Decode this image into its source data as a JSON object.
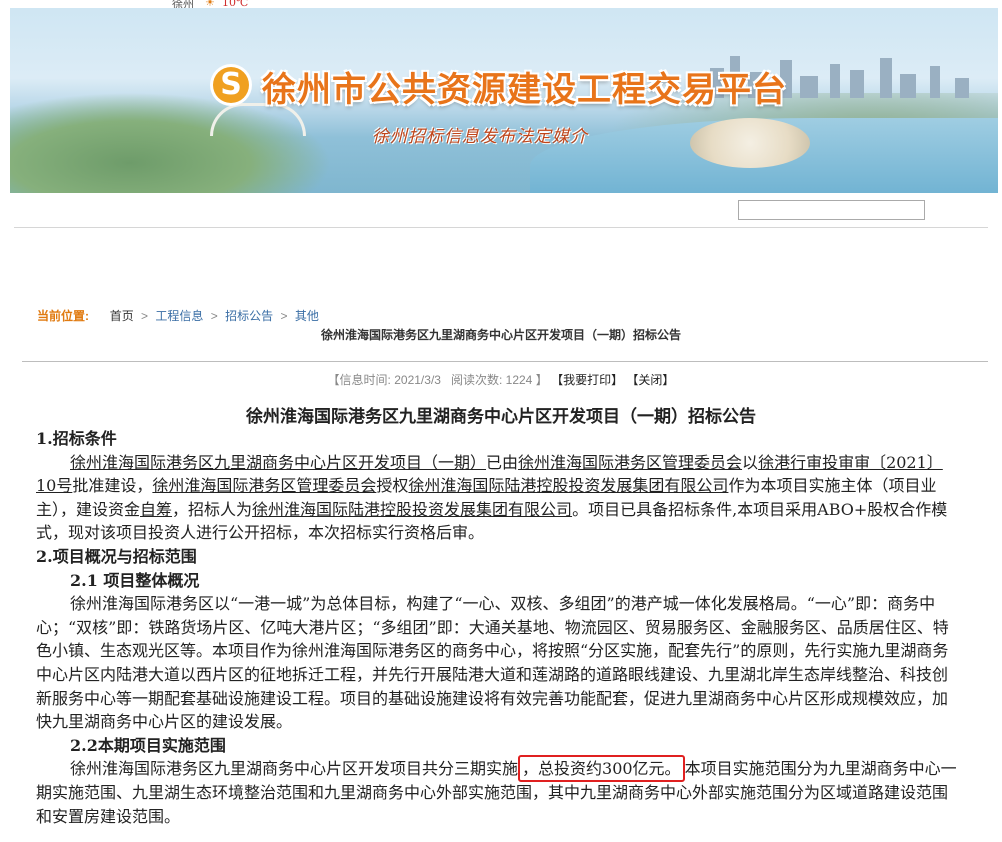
{
  "topstrip": {
    "city": "徐州",
    "weather_text": "10℃"
  },
  "banner": {
    "logo_char": "S",
    "title": "徐州市公共资源建设工程交易平台",
    "subtitle": "徐州招标信息发布法定媒介"
  },
  "breadcrumb": {
    "label": "当前位置:",
    "items": [
      "首页",
      "工程信息",
      "招标公告",
      "其他"
    ],
    "separator": ">"
  },
  "page_heading": "徐州淮海国际港务区九里湖商务中心片区开发项目（一期）招标公告",
  "meta": {
    "info_time_label": "【信息时间:",
    "info_time": "2021/3/3",
    "read_label": "阅读次数:",
    "read_count": "1224",
    "print_label": "【我要打印】",
    "close_label": "【关闭】"
  },
  "document": {
    "title": "徐州淮海国际港务区九里湖商务中心片区开发项目（一期）招标公告",
    "s1_heading": "1.招标条件",
    "s1_p1_a": "徐州淮海国际港务区九里湖商务中心片区开发项目（一期）",
    "s1_p1_b": "已由",
    "s1_p1_c": "徐州淮海国际港务区管理委员会",
    "s1_p1_d": "以",
    "s1_p1_e": "徐港行审投审审〔2021〕10号",
    "s1_p1_f": "批准建设，",
    "s1_p1_g": "徐州淮海国际港务区管理委员会",
    "s1_p1_h": "授权",
    "s1_p1_i": "徐州淮海国际陆港控股投资发展集团有限公司",
    "s1_p1_j": "作为本项目实施主体（项目业主），建设资金",
    "s1_p1_k": "自筹",
    "s1_p1_l": "，招标人为",
    "s1_p1_m": "徐州淮海国际陆港控股投资发展集团有限公司",
    "s1_p1_n": "。项目已具备招标条件,本项目采用ABO+股权合作模式，现对该项目投资人进行公开招标，本次招标实行资格后审。",
    "s2_heading": "2.项目概况与招标范围",
    "s21_heading": "2.1 项目整体概况",
    "s21_body": "徐州淮海国际港务区以“一港一城”为总体目标，构建了“一心、双核、多组团”的港产城一体化发展格局。“一心”即：商务中心；“双核”即：铁路货场片区、亿吨大港片区；“多组团”即：大通关基地、物流园区、贸易服务区、金融服务区、品质居住区、特色小镇、生态观光区等。本项目作为徐州淮海国际港务区的商务中心，将按照“分区实施，配套先行”的原则，先行实施九里湖商务中心片区内陆港大道以西片区的征地拆迁工程，并先行开展陆港大道和莲湖路的道路眼线建设、九里湖北岸生态岸线整治、科技创新服务中心等一期配套基础设施建设工程。项目的基础设施建设将有效完善功能配套，促进九里湖商务中心片区形成规模效应，加快九里湖商务中心片区的建设发展。",
    "s22_heading": "2.2本期项目实施范围",
    "s22_a": "徐州淮海国际港务区九里湖商务中心片区开发项目共分三期实施",
    "s22_highlight": "，总投资约300亿元。",
    "s22_b": "本项目实施范围分为九里湖商务中心一期实施范围、九里湖生态环境整治范围和九里湖商务中心外部实施范围，其中九里湖商务中心外部实施范围分为区域道路建设范围和安置房建设范围。"
  }
}
